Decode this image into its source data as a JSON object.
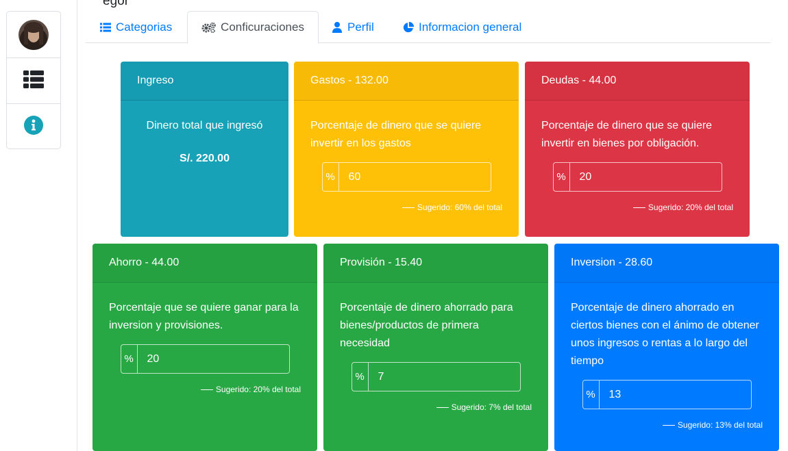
{
  "header": {
    "partial_title": "egor"
  },
  "sidebar": {
    "items": [
      {
        "name": "avatar",
        "icon": "user-avatar"
      },
      {
        "name": "list",
        "icon": "th-list-icon"
      },
      {
        "name": "info",
        "icon": "info-circle-icon"
      }
    ]
  },
  "tabs": [
    {
      "label": "Categorias",
      "icon": "list-icon",
      "active": false
    },
    {
      "label": "Conficuraciones",
      "icon": "cogs-icon",
      "active": true
    },
    {
      "label": "Perfil",
      "icon": "user-icon",
      "active": false
    },
    {
      "label": "Informacion general",
      "icon": "pie-chart-icon",
      "active": false
    }
  ],
  "cards": {
    "ingreso": {
      "title": "Ingreso",
      "description": "Dinero total que ingresó",
      "amount": "S/. 220.00",
      "color": "#17a2b8"
    },
    "gastos": {
      "title": "Gastos - 132.00",
      "description": "Porcentaje de dinero que se quiere invertir en los gastos",
      "prefix": "%",
      "value": "60",
      "hint": "Sugerido: 60% del total",
      "color": "#ffc107"
    },
    "deudas": {
      "title": "Deudas - 44.00",
      "description": "Porcentaje de dinero que se quiere invertir en bienes por obligación.",
      "prefix": "%",
      "value": "20",
      "hint": "Sugerido: 20% del total",
      "color": "#dc3545"
    },
    "ahorro": {
      "title": "Ahorro - 44.00",
      "description": "Porcentaje que se quiere ganar para la inversion y provisiones.",
      "prefix": "%",
      "value": "20",
      "hint": "Sugerido: 20% del total",
      "color": "#28a745"
    },
    "provision": {
      "title": "Provisión - 15.40",
      "description": "Porcentaje de dinero ahorrado para bienes/productos de primera necesidad",
      "prefix": "%",
      "value": "7",
      "hint": "Sugerido: 7% del total",
      "color": "#28a745"
    },
    "inversion": {
      "title": "Inversion - 28.60",
      "description": "Porcentaje de dinero ahorrado en ciertos bienes con el ánimo de obtener unos ingresos o rentas a lo largo del tiempo",
      "prefix": "%",
      "value": "13",
      "hint": "Sugerido: 13% del total",
      "color": "#007bff"
    }
  }
}
